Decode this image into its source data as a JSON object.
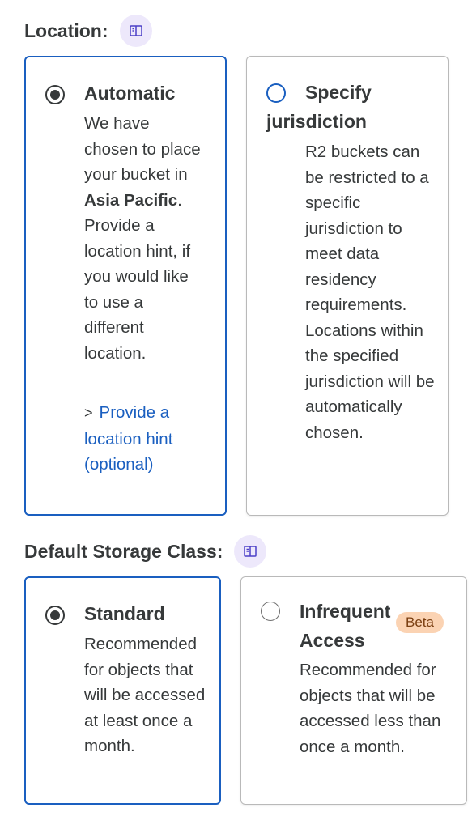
{
  "location": {
    "title": "Location:",
    "doc_icon": "book-icon",
    "options": [
      {
        "title": "Automatic",
        "desc_prefix": "We have chosen to place your bucket in ",
        "desc_bold": "Asia Pacific",
        "desc_suffix": ". Provide a location hint, if you would like to use a different location.",
        "hint_link": "Provide a location hint (optional)",
        "selected": true
      },
      {
        "title_line1": "Specify",
        "title_line2": "jurisdiction",
        "desc": "R2 buckets can be restricted to a specific jurisdiction to meet data residency requirements. Locations within the specified jurisdiction will be automatically chosen.",
        "selected": false
      }
    ]
  },
  "storage_class": {
    "title": "Default Storage Class:",
    "doc_icon": "book-icon",
    "options": [
      {
        "title": "Standard",
        "desc": "Recommended for objects that will be accessed at least once a month.",
        "selected": true
      },
      {
        "title_line1": "Infrequent",
        "title_line2": "Access",
        "badge": "Beta",
        "desc": "Recommended for objects that will be accessed less than once a month.",
        "selected": false
      }
    ]
  },
  "colors": {
    "accent": "#1a5fc0",
    "text": "#36393a",
    "badge_bg": "#ede8fb",
    "beta_bg": "#fbd3b3"
  }
}
